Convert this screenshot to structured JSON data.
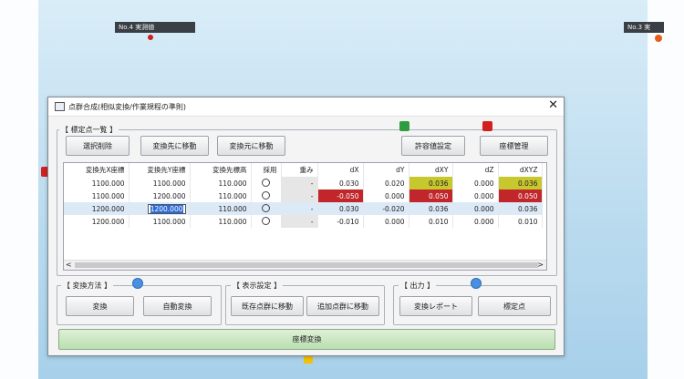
{
  "markers": {
    "top_left_label": "No.4 実測値",
    "top_right_label": "No.3 実",
    "colors": {
      "red": "#d21f1f",
      "green": "#2f9d3f",
      "yellow": "#f2c200",
      "blue": "#4a90e2"
    }
  },
  "dialog": {
    "title": "点群合成(相似変換/作業規程の準則)",
    "close_glyph": "✕",
    "control_points": {
      "group_label": "【 標定点一覧 】",
      "buttons": {
        "delete": "選択削除",
        "move_dest": "変換先に移動",
        "move_src": "変換元に移動",
        "tolerance": "許容値設定",
        "coord_manage": "座標管理"
      },
      "columns": [
        "変換先X座標",
        "変換先Y座標",
        "変換先標高",
        "採用",
        "重み",
        "dX",
        "dY",
        "dXY",
        "dZ",
        "dXYZ"
      ],
      "rows": [
        [
          "1100.000",
          "1100.000",
          "110.000",
          "",
          "-",
          "0.030",
          "0.020",
          "0.036",
          "0.000",
          "0.036"
        ],
        [
          "1100.000",
          "1200.000",
          "110.000",
          "",
          "-",
          "-0.050",
          "0.000",
          "0.050",
          "0.000",
          "0.050"
        ],
        [
          "1200.000",
          "1200.000",
          "110.000",
          "",
          "-",
          "0.030",
          "-0.020",
          "0.036",
          "0.000",
          "0.036"
        ],
        [
          "1200.000",
          "1100.000",
          "110.000",
          "",
          "-",
          "-0.010",
          "0.000",
          "0.010",
          "0.000",
          "0.010"
        ]
      ],
      "scroll_left": "<",
      "scroll_right": ">"
    },
    "transform_method": {
      "group_label": "【 変換方法 】",
      "convert": "変換",
      "auto_convert": "自動変換"
    },
    "display_settings": {
      "group_label": "【 表示設定 】",
      "move_existing": "既存点群に移動",
      "move_added": "追加点群に移動"
    },
    "output": {
      "group_label": "【 出力 】",
      "report": "変換レポート",
      "control_point": "標定点"
    },
    "execute": "座標変換"
  }
}
